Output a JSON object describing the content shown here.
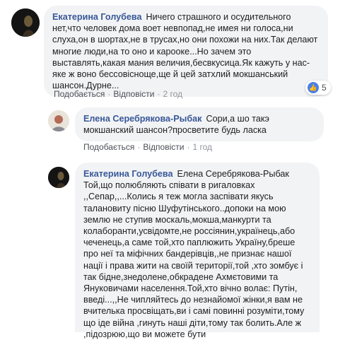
{
  "comments": [
    {
      "author": "Екатерина Голубева",
      "text": "Ничего страшного и осудительного нет,что человек дома воет невпопад,не имея ни голоса,ни слуха,он в шортах,не в трусах,но они похожи на них.Так делают многие люди,на то оно и карооке...Но зачем это выставлять,какая мания величия,бесвкусица.Як кажуть у нас-яке ж воно бессовісноще,ще й цей затхлий мокшанський шансон.Дурне...",
      "like": "Подобається",
      "reply": "Відповісти",
      "time": "2 год",
      "reactions_count": "5"
    },
    {
      "author": "Елена Серебрякова-Рыбак",
      "text": "Сори,а шо такэ мокшанский шансон?просветите будь ласка",
      "like": "Подобається",
      "reply": "Відповісти",
      "time": "1 год"
    },
    {
      "author": "Екатерина Голубева",
      "text": "Елена Серебрякова-Рыбак Той,що полюбляють співати в ригаловках ,,Сепар,,...Колись я теж могла заспівати якусь талановиту пісню Шуфутінського..допоки на мою землю не ступив москаль,мокша,манкурти та колаборанти,усвідомте,не россіянин,українець,або чеченець,а саме той,хто паплюжить Україну,бреше про неї та міфічних бандерівців,,не признає нашої нації і права жити на своїй території,той ,хто зомбує і так бідне,знедолене,обкрадене Ахмєтовими та Януковичами населення.Той,хто вічно волає: Путін, введі...,,Не чипляйтесь до незнайомої жінки,я вам не вчителька просвіщать,ви і самі повинні розуміти,тому що іде війна ,гинуть наші діти,тому так болить.Але ж ,підозрюю,що ви можете бути"
    }
  ]
}
